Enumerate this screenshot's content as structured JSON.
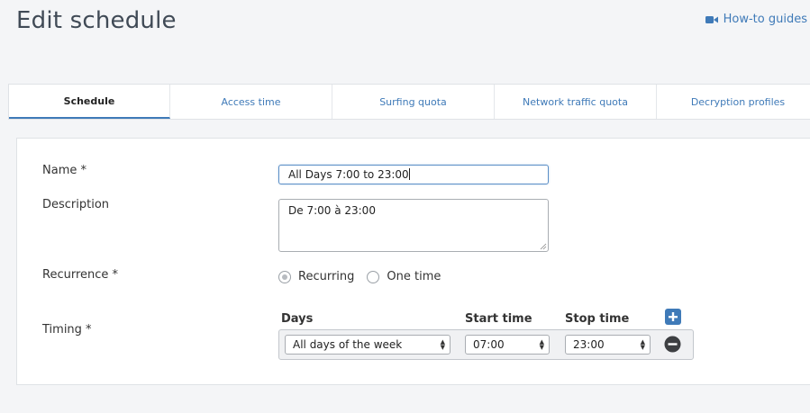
{
  "page": {
    "title": "Edit schedule"
  },
  "header": {
    "howto_label": "How-to guides"
  },
  "tabs": [
    {
      "label": "Schedule"
    },
    {
      "label": "Access time"
    },
    {
      "label": "Surfing quota"
    },
    {
      "label": "Network traffic quota"
    },
    {
      "label": "Decryption profiles"
    }
  ],
  "form": {
    "name_label": "Name *",
    "name_value": "All Days 7:00 to 23:00",
    "description_label": "Description",
    "description_value": "De 7:00 à 23:00",
    "recurrence_label": "Recurrence *",
    "recurrence_options": [
      "Recurring",
      "One time"
    ],
    "recurrence_selected": "Recurring",
    "timing_label": "Timing *",
    "timing_headers": {
      "days": "Days",
      "start": "Start time",
      "stop": "Stop time"
    },
    "timing_row": {
      "days": "All days of the week",
      "start": "07:00",
      "stop": "23:00"
    }
  },
  "colors": {
    "accent": "#3f7ab8",
    "add_button": "#3f7ab8",
    "remove_button": "#3d3f42"
  },
  "icons": {
    "howto": "video-camera-icon",
    "add": "plus-icon",
    "remove": "minus-icon"
  }
}
